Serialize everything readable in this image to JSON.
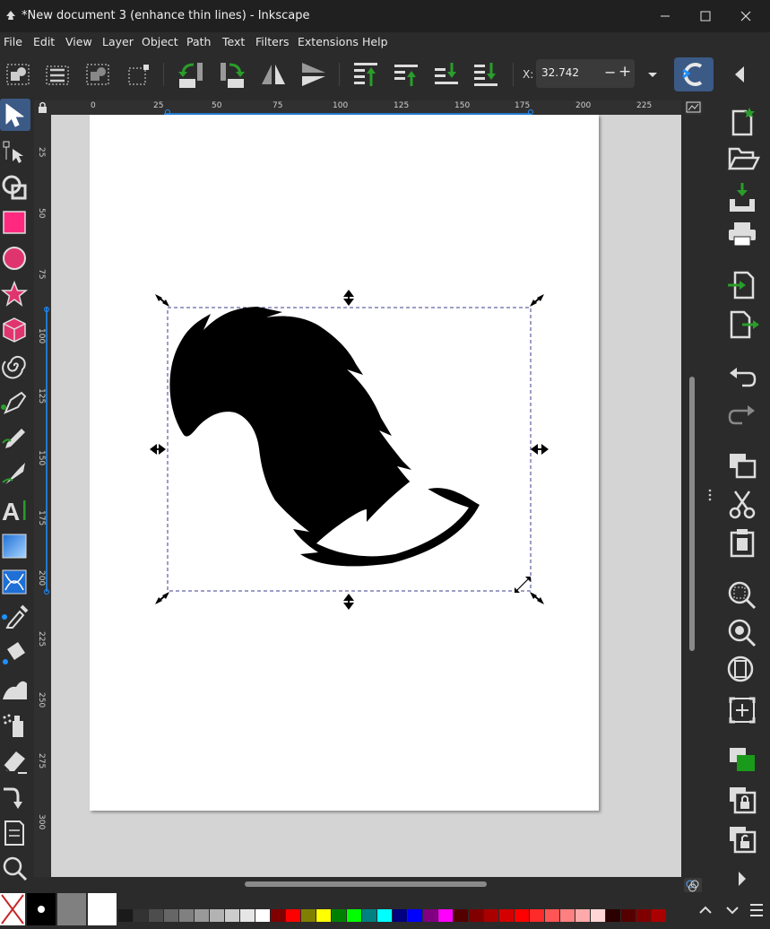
{
  "window": {
    "title": "*New document 3 (enhance thin lines) - Inkscape"
  },
  "menubar": {
    "items": [
      "File",
      "Edit",
      "View",
      "Layer",
      "Object",
      "Path",
      "Text",
      "Filters",
      "Extensions",
      "Help"
    ]
  },
  "toolbar": {
    "x_label": "X:",
    "x_value": "32.742",
    "minus_label": "−",
    "plus_label": "+"
  },
  "rulers": {
    "horizontal_ticks": [
      "0",
      "25",
      "50",
      "75",
      "100",
      "125",
      "150",
      "175",
      "200",
      "225"
    ],
    "vertical_ticks": [
      "25",
      "50",
      "75",
      "100",
      "125",
      "150",
      "175",
      "200",
      "225",
      "250",
      "275",
      "300"
    ]
  },
  "tools": [
    "selector-tool",
    "node-tool",
    "tweak-tool",
    "rectangle-tool",
    "ellipse-tool",
    "star-tool",
    "3d-box-tool",
    "spiral-tool",
    "pen-tool",
    "pencil-tool",
    "calligraphy-tool",
    "text-tool",
    "gradient-tool",
    "mesh-tool",
    "dropper-tool",
    "paint-bucket-tool",
    "tweak-wave-tool",
    "spray-tool",
    "eraser-tool",
    "connector-tool",
    "pages-tool",
    "zoom-tool"
  ],
  "commands": [
    "new-document",
    "open-document",
    "save-document",
    "print-document",
    "import",
    "export",
    "undo",
    "redo",
    "duplicate",
    "cut",
    "paste",
    "zoom-selection",
    "zoom-drawing",
    "zoom-page",
    "zoom-center",
    "fill-stroke",
    "lock",
    "unlock",
    "more"
  ],
  "palette": {
    "colors": [
      "#1a1a1a",
      "#333333",
      "#4d4d4d",
      "#666666",
      "#808080",
      "#999999",
      "#b3b3b3",
      "#cccccc",
      "#e6e6e6",
      "#ffffff",
      "#800000",
      "#ff0000",
      "#808000",
      "#ffff00",
      "#008000",
      "#00ff00",
      "#008080",
      "#00ffff",
      "#000080",
      "#0000ff",
      "#800080",
      "#ff00ff",
      "#550000",
      "#800000",
      "#aa0000",
      "#d40000",
      "#ff0000",
      "#ff2a2a",
      "#ff5555",
      "#ff8080",
      "#ffaaaa",
      "#ffd5d5",
      "#2b0000",
      "#550000",
      "#800000",
      "#aa0000"
    ]
  }
}
